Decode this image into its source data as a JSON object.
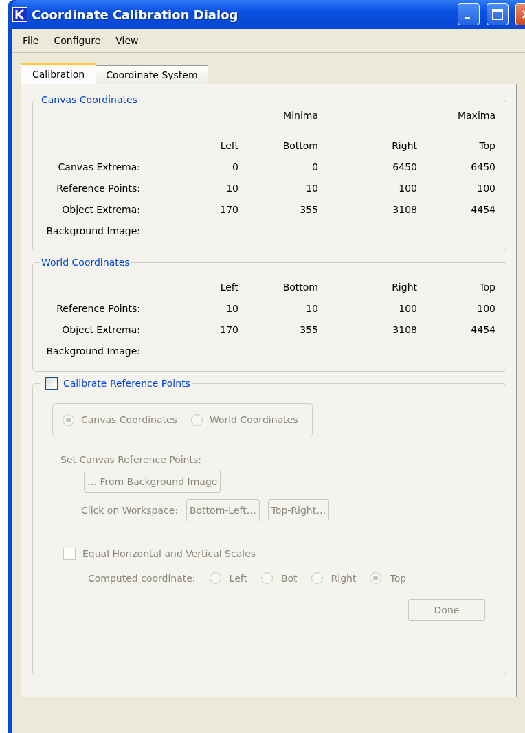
{
  "window": {
    "title": "Coordinate Calibration Dialog"
  },
  "menu": [
    "File",
    "Configure",
    "View"
  ],
  "tabs": [
    {
      "label": "Calibration",
      "selected": true
    },
    {
      "label": "Coordinate System",
      "selected": false
    }
  ],
  "canvas_coordinates": {
    "title": "Canvas Coordinates",
    "columns": [
      {
        "label": "Left"
      },
      {
        "label": "Bottom",
        "group": "Minima"
      },
      {
        "label": "Right"
      },
      {
        "label": "Top",
        "group": "Maxima"
      }
    ],
    "rows": [
      {
        "label": "Canvas Extrema:",
        "values": [
          "0",
          "0",
          "6450",
          "6450"
        ]
      },
      {
        "label": "Reference Points:",
        "values": [
          "10",
          "10",
          "100",
          "100"
        ]
      },
      {
        "label": "Object Extrema:",
        "values": [
          "170",
          "355",
          "3108",
          "4454"
        ]
      },
      {
        "label": "Background Image:"
      }
    ]
  },
  "world_coordinates": {
    "title": "World Coordinates",
    "columns": [
      {
        "label": "Left"
      },
      {
        "label": "Bottom"
      },
      {
        "label": "Right"
      },
      {
        "label": "Top"
      }
    ],
    "rows": [
      {
        "label": "Reference Points:",
        "values": [
          "10",
          "10",
          "100",
          "100"
        ]
      },
      {
        "label": "Object Extrema:",
        "values": [
          "170",
          "355",
          "3108",
          "4454"
        ]
      },
      {
        "label": "Background Image:"
      }
    ]
  },
  "calibrate": {
    "title": "Calibrate Reference Points",
    "checked": false,
    "disabled": true,
    "mode_options": [
      {
        "label": "Canvas Coordinates",
        "selected": true
      },
      {
        "label": "World Coordinates",
        "selected": false
      }
    ],
    "set_label": "Set Canvas Reference Points:",
    "from_image_button": "… From Background Image",
    "workspace_label": "Click on Workspace:",
    "workspace_buttons": [
      "Bottom-Left…",
      "Top-Right…"
    ],
    "equal_scales": {
      "label": "Equal Horizontal and Vertical Scales",
      "checked": false
    },
    "computed_label": "Computed coordinate:",
    "computed_options": [
      {
        "label": "Left",
        "selected": false
      },
      {
        "label": "Bot",
        "selected": false
      },
      {
        "label": "Right",
        "selected": false
      },
      {
        "label": "Top",
        "selected": true
      }
    ],
    "done_button": "Done"
  }
}
